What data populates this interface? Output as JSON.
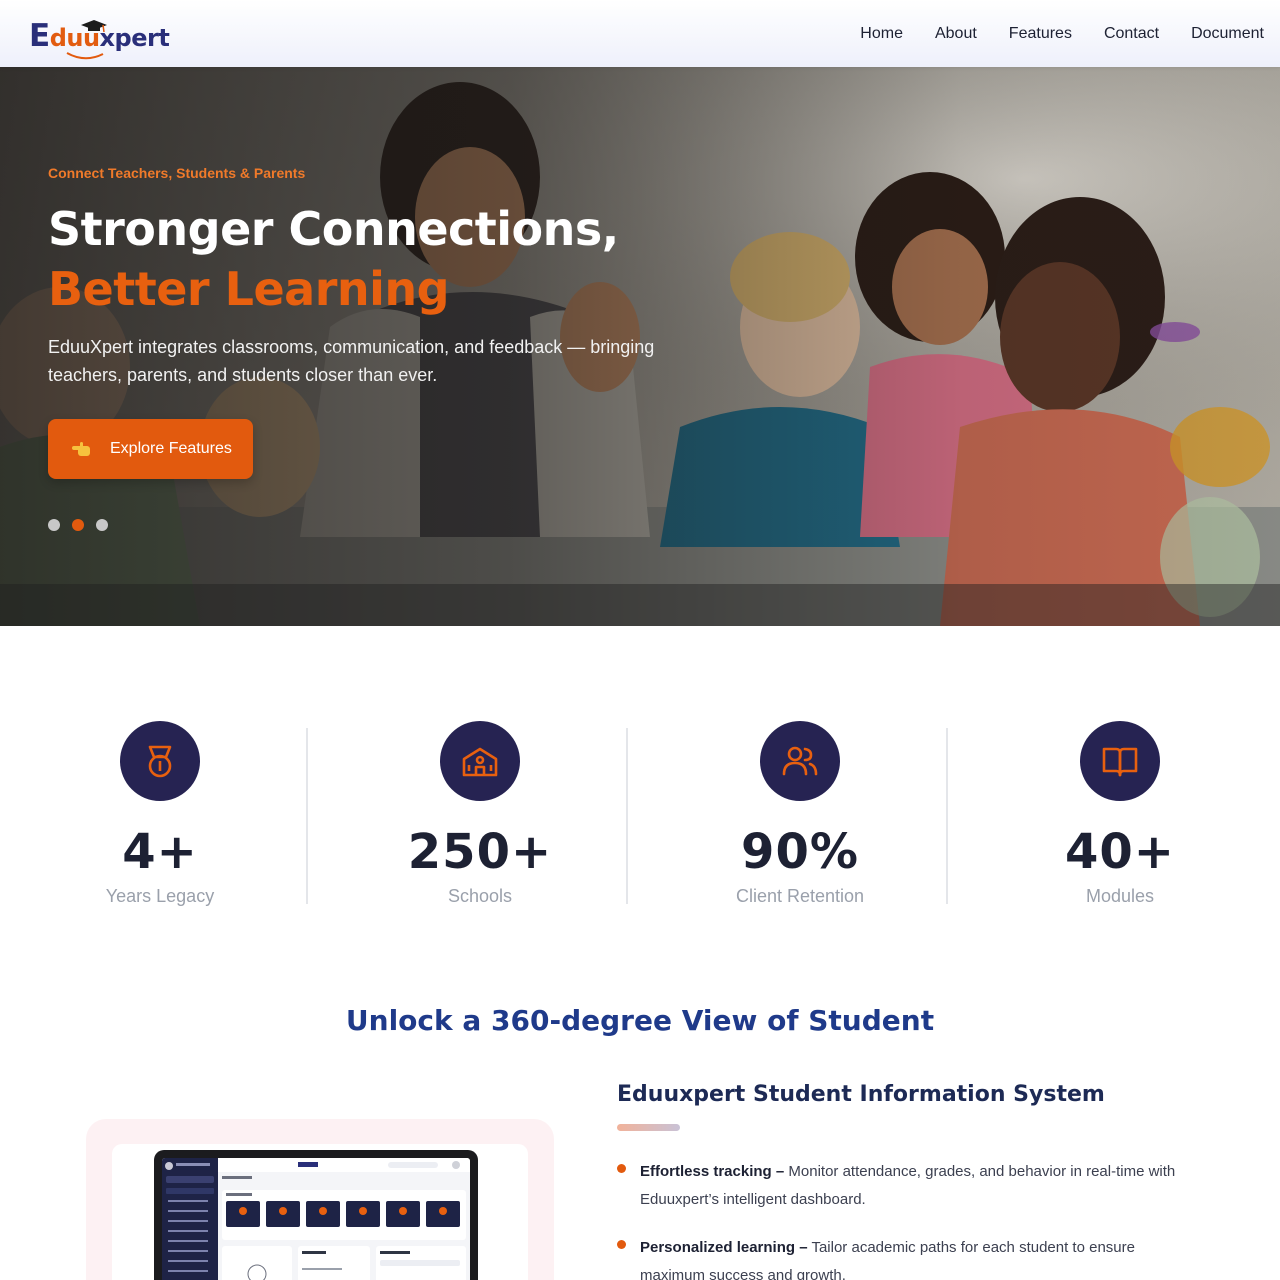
{
  "brand": {
    "logo_e": "E",
    "logo_uu": "duu",
    "logo_rest": "xpert"
  },
  "nav": {
    "items": [
      {
        "label": "Home"
      },
      {
        "label": "About"
      },
      {
        "label": "Features"
      },
      {
        "label": "Contact"
      },
      {
        "label": "Document"
      }
    ]
  },
  "hero": {
    "eyebrow": "Connect Teachers, Students & Parents",
    "title_line1": "Stronger Connections,",
    "title_line2": "Better Learning",
    "description": "EduuXpert integrates classrooms, communication, and feedback — bringing teachers, parents, and students closer than ever.",
    "cta_icon": "pointing-hand-icon",
    "cta_label": "Explore Features",
    "slides_count": 3,
    "active_slide": 2
  },
  "stats": [
    {
      "icon": "medal-icon",
      "value": "4+",
      "label": "Years Legacy"
    },
    {
      "icon": "school-icon",
      "value": "250+",
      "label": "Schools"
    },
    {
      "icon": "users-icon",
      "value": "90%",
      "label": "Client Retention"
    },
    {
      "icon": "book-icon",
      "value": "40+",
      "label": "Modules"
    }
  ],
  "section": {
    "title": "Unlock a 360-degree View of Student"
  },
  "sis": {
    "title": "Eduuxpert Student Information System",
    "bullets": [
      {
        "strong": "Effortless tracking –",
        "text": " Monitor attendance, grades, and behavior in real-time with Eduuxpert’s intelligent dashboard."
      },
      {
        "strong": "Personalized learning –",
        "text": " Tailor academic paths for each student to ensure maximum success and growth."
      }
    ]
  },
  "mockup": {
    "screen_title": "Dashboard",
    "quick_actions_label": "Quick Actions",
    "my_tasks_label": "My Tasks",
    "bank_label": "Bank Transaction"
  },
  "colors": {
    "accent": "#e25a0e",
    "navy": "#262352",
    "heading_blue": "#1f3a8a"
  }
}
